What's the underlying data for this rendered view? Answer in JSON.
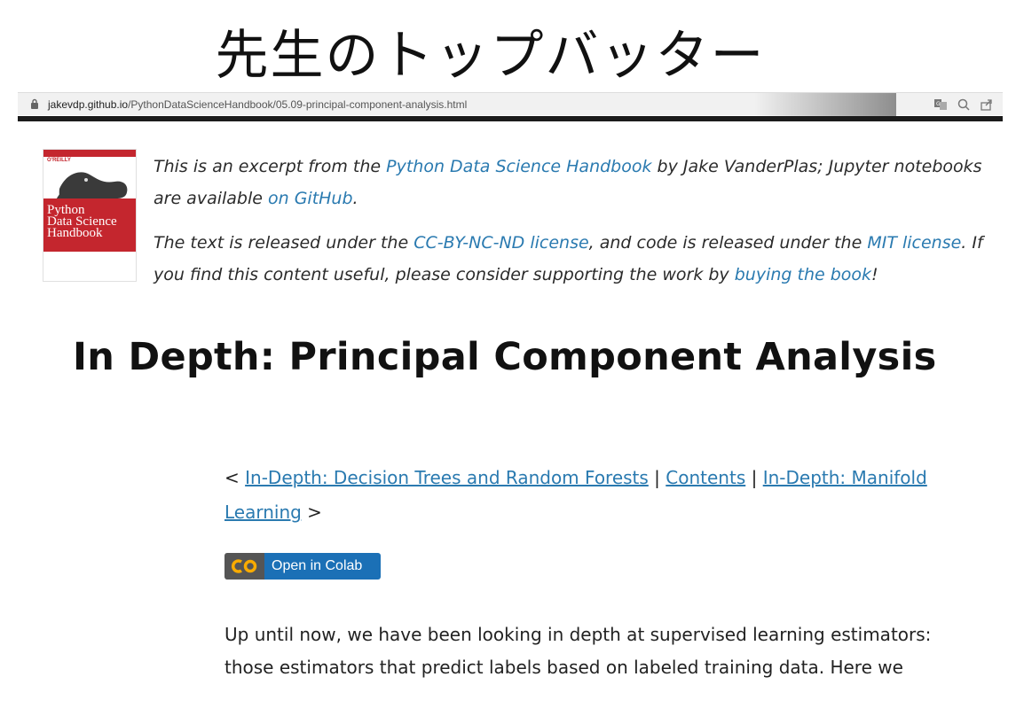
{
  "slide": {
    "title": "先生のトップバッター"
  },
  "browser": {
    "url_domain": "jakevdp.github.io",
    "url_path": "/PythonDataScienceHandbook/05.09-principal-component-analysis.html"
  },
  "cover": {
    "publisher": "O'REILLY",
    "title_line1": "Python",
    "title_line2": "Data Science",
    "title_line3": "Handbook"
  },
  "intro": {
    "p1_before": "This is an excerpt from the ",
    "p1_link1": "Python Data Science Handbook",
    "p1_mid": " by Jake VanderPlas; Jupyter notebooks are available ",
    "p1_link2": "on GitHub",
    "p1_end": ".",
    "p2_before": "The text is released under the ",
    "p2_link1": "CC-BY-NC-ND license",
    "p2_mid": ", and code is released under the ",
    "p2_link2": "MIT license",
    "p2_mid2": ". If you find this content useful, please consider supporting the work by ",
    "p2_link3": "buying the book",
    "p2_end": "!"
  },
  "heading": "In Depth: Principal Component Analysis",
  "nav": {
    "lt": "< ",
    "prev": "In-Depth: Decision Trees and Random Forests",
    "sep1": " | ",
    "contents": "Contents",
    "sep2": " | ",
    "next": "In-Depth: Manifold Learning",
    "gt": " >"
  },
  "colab": {
    "label": "Open in Colab"
  },
  "body": {
    "text": "Up until now, we have been looking in depth at supervised learning estimators: those estimators that predict labels based on labeled training data. Here we"
  }
}
